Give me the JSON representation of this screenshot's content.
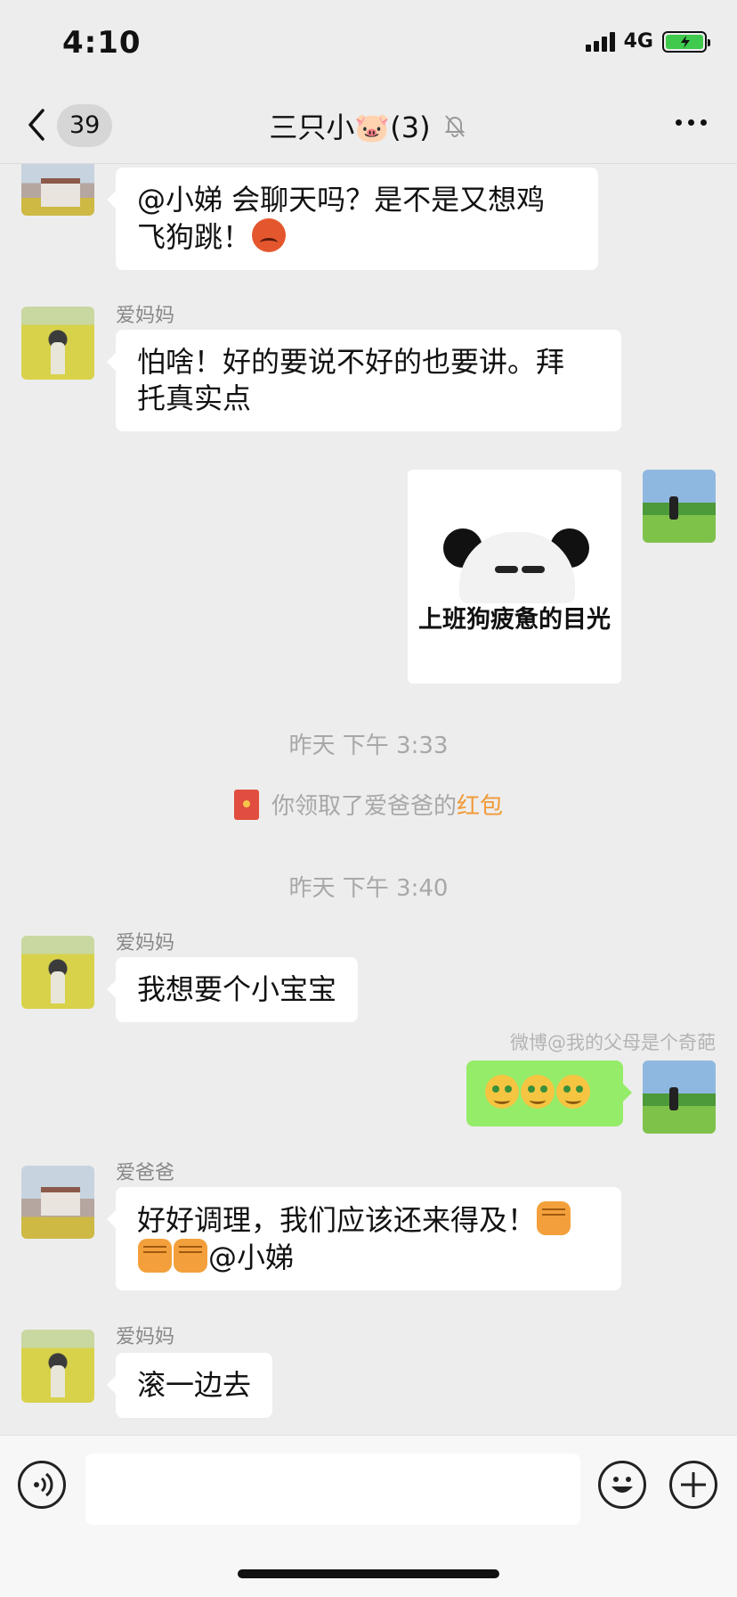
{
  "status_bar": {
    "time": "4:10",
    "network": "4G"
  },
  "nav": {
    "unread_count": "39",
    "title": "三只小🐷(3)"
  },
  "messages": [
    {
      "text_a": "@小娣 会聊天吗？是不是又想鸡",
      "text_b": "飞狗跳！"
    },
    {
      "sender": "爱妈妈",
      "text_a": "怕啥！好的要说不好的也要讲。拜",
      "text_b": "托真实点"
    },
    {
      "sticker_caption": "上班狗疲惫的目光"
    },
    {
      "sender": "爱妈妈",
      "text": "我想要个小宝宝"
    },
    {
      "watermark": "微博@我的父母是个奇葩"
    },
    {
      "sender": "爱爸爸",
      "text_a": "好好调理，我们应该还来得及！",
      "text_b": "@小娣"
    },
    {
      "sender": "爱妈妈",
      "text": "滚一边去"
    }
  ],
  "system": {
    "time_1": "昨天 下午 3:33",
    "hongbao_prefix": "你领取了爱爸爸的",
    "hongbao_link": "红包",
    "time_2": "昨天 下午 3:40"
  },
  "icons": {
    "back": "chevron-left-icon",
    "mute": "bell-off-icon",
    "more": "more-icon",
    "voice": "voice-icon",
    "emoji": "smiley-icon",
    "plus": "plus-icon",
    "hongbao": "red-envelope-icon"
  },
  "colors": {
    "background": "#ededed",
    "my_bubble": "#95ec69",
    "hongbao_link": "#f19a37",
    "battery": "#3fc94d"
  }
}
